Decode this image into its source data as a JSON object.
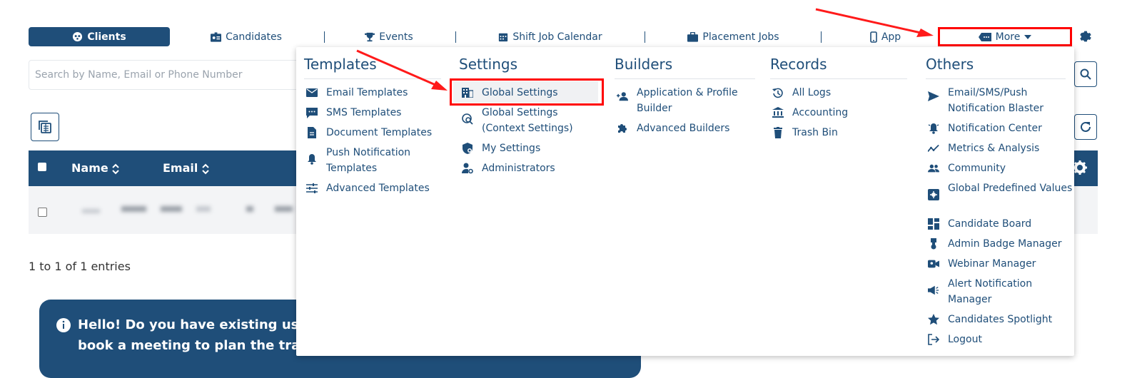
{
  "nav": {
    "clients": "Clients",
    "candidates": "Candidates",
    "events": "Events",
    "shift_job_calendar": "Shift Job Calendar",
    "placement_jobs": "Placement Jobs",
    "app": "App",
    "more": "More"
  },
  "search": {
    "placeholder": "Search by Name, Email or Phone Number"
  },
  "table": {
    "headers": [
      "Name",
      "Email"
    ]
  },
  "entries": "1 to 1 of 1 entries",
  "banner": {
    "line1": "Hello! Do you have existing user d",
    "line2": "book a meeting to plan the transf"
  },
  "menu": {
    "templates": {
      "title": "Templates",
      "items": [
        "Email Templates",
        "SMS Templates",
        "Document Templates",
        "Push Notification Templates",
        "Advanced Templates"
      ]
    },
    "settings": {
      "title": "Settings",
      "items": [
        "Global Settings",
        "Global Settings (Context Settings)",
        "My Settings",
        "Administrators"
      ]
    },
    "builders": {
      "title": "Builders",
      "items": [
        "Application & Profile Builder",
        "Advanced Builders"
      ]
    },
    "records": {
      "title": "Records",
      "items": [
        "All Logs",
        "Accounting",
        "Trash Bin"
      ]
    },
    "others": {
      "title": "Others",
      "items": [
        "Email/SMS/Push Notification Blaster",
        "Notification Center",
        "Metrics & Analysis",
        "Community",
        "Global Predefined Values",
        "Candidate Board",
        "Admin Badge Manager",
        "Webinar Manager",
        "Alert Notification Manager",
        "Candidates Spotlight",
        "Logout"
      ]
    }
  },
  "colors": {
    "primary": "#1f4e79",
    "highlight": "#ff0000",
    "row_bg": "#f3f4f6"
  }
}
